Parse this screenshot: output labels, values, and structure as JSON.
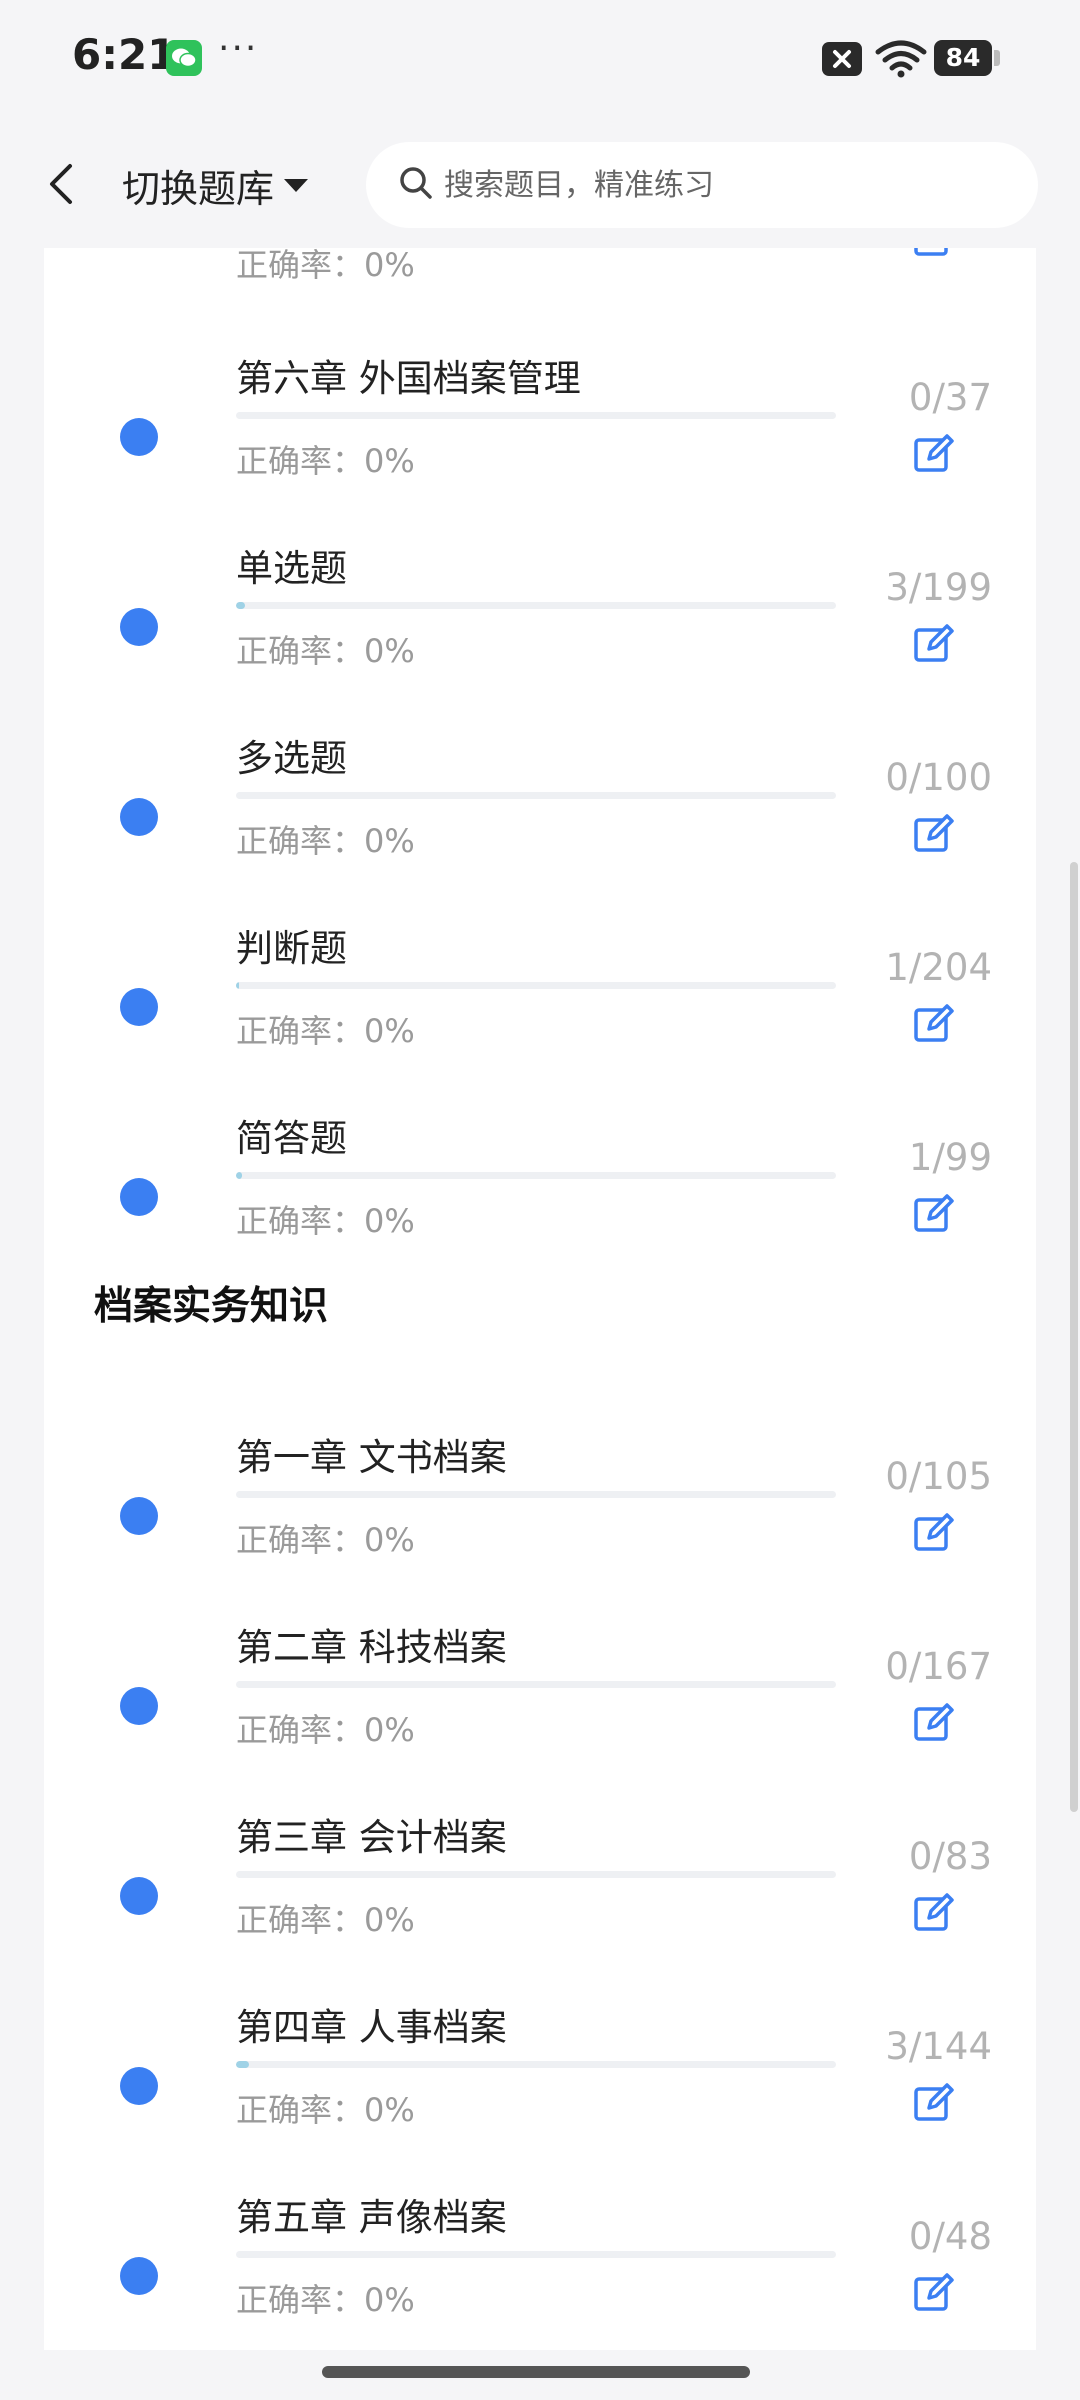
{
  "status_bar": {
    "time": "6:21",
    "dots": "···",
    "battery": "84"
  },
  "header": {
    "bank_switch": "切换题库",
    "search_placeholder": "搜索题目，精准练习"
  },
  "partial_top": {
    "accuracy": "正确率：0%"
  },
  "group1": {
    "items": [
      {
        "title": "第六章 外国档案管理",
        "count": "0/37",
        "accuracy": "正确率：0%",
        "progress": 0
      },
      {
        "title": "单选题",
        "count": "3/199",
        "accuracy": "正确率：0%",
        "progress": 0.015
      },
      {
        "title": "多选题",
        "count": "0/100",
        "accuracy": "正确率：0%",
        "progress": 0
      },
      {
        "title": "判断题",
        "count": "1/204",
        "accuracy": "正确率：0%",
        "progress": 0.005
      },
      {
        "title": "简答题",
        "count": "1/99",
        "accuracy": "正确率：0%",
        "progress": 0.01
      }
    ]
  },
  "section2": {
    "title": "档案实务知识",
    "items": [
      {
        "title": "第一章 文书档案",
        "count": "0/105",
        "accuracy": "正确率：0%",
        "progress": 0
      },
      {
        "title": "第二章 科技档案",
        "count": "0/167",
        "accuracy": "正确率：0%",
        "progress": 0
      },
      {
        "title": "第三章 会计档案",
        "count": "0/83",
        "accuracy": "正确率：0%",
        "progress": 0
      },
      {
        "title": "第四章 人事档案",
        "count": "3/144",
        "accuracy": "正确率：0%",
        "progress": 0.021
      },
      {
        "title": "第五章 声像档案",
        "count": "0/48",
        "accuracy": "正确率：0%",
        "progress": 0
      }
    ]
  },
  "colors": {
    "accent": "#3b7ff2",
    "progress_fill": "#9fd2e6",
    "muted_text": "#9a9a9a"
  },
  "icons": {
    "edit": "edit-icon",
    "back": "back-icon",
    "search": "search-icon"
  }
}
